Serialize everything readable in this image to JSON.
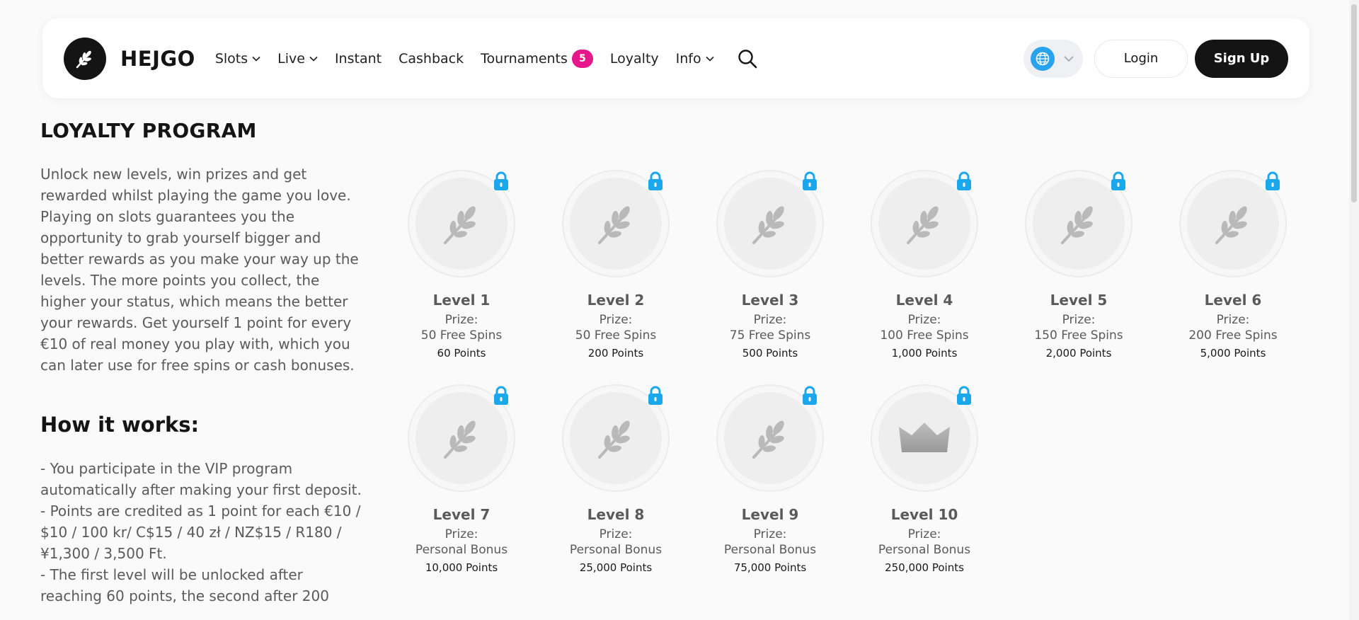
{
  "header": {
    "brand": "HEJGO",
    "nav": [
      {
        "label": "Slots",
        "dropdown": true
      },
      {
        "label": "Live",
        "dropdown": true
      },
      {
        "label": "Instant",
        "dropdown": false
      },
      {
        "label": "Cashback",
        "dropdown": false
      },
      {
        "label": "Tournaments",
        "dropdown": false,
        "badge": "5"
      },
      {
        "label": "Loyalty",
        "dropdown": false
      },
      {
        "label": "Info",
        "dropdown": true
      }
    ],
    "login_label": "Login",
    "signup_label": "Sign Up"
  },
  "main": {
    "title": "LOYALTY PROGRAM",
    "intro": "Unlock new levels, win prizes and get rewarded whilst playing the game you love. Playing on slots guarantees you the opportunity to grab yourself bigger and better rewards as you make your way up the levels. The more points you collect, the higher your status, which means the better your rewards. Get yourself 1 point for every €10 of real money you play with, which you can later use for free spins or cash bonuses.",
    "how_title": "How it works:",
    "how_lines": [
      "- You participate in the VIP program automatically after making your first deposit.",
      "- Points are credited as 1 point for each €10 / $10 / 100 kr/ C$15 / 40 zł / NZ$15 / R180 / ¥1,300 / 3,500 Ft.",
      "- The first level will be unlocked after reaching 60 points, the second after 200"
    ]
  },
  "levels": [
    {
      "name": "Level 1",
      "prize_label": "Prize:",
      "prize": "50 Free Spins",
      "points": "60 Points",
      "icon": "leaf-icon"
    },
    {
      "name": "Level 2",
      "prize_label": "Prize:",
      "prize": "50 Free Spins",
      "points": "200 Points",
      "icon": "leaf-icon"
    },
    {
      "name": "Level 3",
      "prize_label": "Prize:",
      "prize": "75 Free Spins",
      "points": "500 Points",
      "icon": "leaf-icon"
    },
    {
      "name": "Level 4",
      "prize_label": "Prize:",
      "prize": "100 Free Spins",
      "points": "1,000 Points",
      "icon": "leaf-icon"
    },
    {
      "name": "Level 5",
      "prize_label": "Prize:",
      "prize": "150 Free Spins",
      "points": "2,000 Points",
      "icon": "leaf-icon"
    },
    {
      "name": "Level 6",
      "prize_label": "Prize:",
      "prize": "200 Free Spins",
      "points": "5,000 Points",
      "icon": "leaf-icon"
    },
    {
      "name": "Level 7",
      "prize_label": "Prize:",
      "prize": "Personal Bonus",
      "points": "10,000 Points",
      "icon": "leaf-icon"
    },
    {
      "name": "Level 8",
      "prize_label": "Prize:",
      "prize": "Personal Bonus",
      "points": "25,000 Points",
      "icon": "leaf-icon"
    },
    {
      "name": "Level 9",
      "prize_label": "Prize:",
      "prize": "Personal Bonus",
      "points": "75,000 Points",
      "icon": "leaf-icon"
    },
    {
      "name": "Level 10",
      "prize_label": "Prize:",
      "prize": "Personal Bonus",
      "points": "250,000 Points",
      "icon": "crown-icon"
    }
  ],
  "colors": {
    "accent_badge": "#e6178a",
    "lock": "#1aa7ec",
    "dark": "#141414"
  }
}
